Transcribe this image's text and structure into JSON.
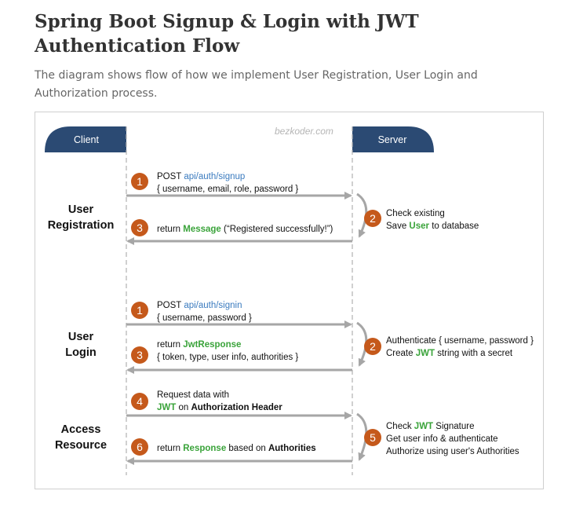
{
  "page": {
    "title": "Spring Boot Signup & Login with JWT Authentication Flow",
    "subtitle": "The diagram shows flow of how we implement User Registration, User Login and Authorization process."
  },
  "diagram": {
    "watermark": "bezkoder.com",
    "client_label": "Client",
    "server_label": "Server",
    "colors": {
      "header": "#2b4a73",
      "step": "#c5591b",
      "arrow": "#a6a6a6",
      "link": "#3b7bbf",
      "highlight": "#3aa33a"
    },
    "sections": {
      "registration": {
        "line1": "User",
        "line2": "Registration"
      },
      "login": {
        "line1": "User",
        "line2": "Login"
      },
      "access": {
        "line1": "Access",
        "line2": "Resource"
      }
    },
    "steps": {
      "reg1": {
        "num": "1",
        "method": "POST ",
        "path": "api/auth/signup",
        "body": "{ username, email, role, password }"
      },
      "reg2": {
        "num": "2",
        "line1": "Check existing",
        "line2_a": "Save ",
        "line2_b": "User",
        "line2_c": " to database"
      },
      "reg3": {
        "num": "3",
        "a": "return ",
        "b": "Message",
        "c": " (“Registered successfully!”)"
      },
      "log1": {
        "num": "1",
        "method": "POST ",
        "path": "api/auth/signin",
        "body": "{ username, password }"
      },
      "log2": {
        "num": "2",
        "line1": "Authenticate { username, password }",
        "line2_a": "Create ",
        "line2_b": "JWT",
        "line2_c": " string with a secret"
      },
      "log3": {
        "num": "3",
        "a": "return ",
        "b": "JwtResponse",
        "body": "{ token, type, user info, authorities }"
      },
      "acc4": {
        "num": "4",
        "line1": "Request  data with",
        "line2_a": "JWT",
        "line2_b": " on ",
        "line2_c": "Authorization Header"
      },
      "acc5": {
        "num": "5",
        "line1_a": "Check ",
        "line1_b": "JWT",
        "line1_c": " Signature",
        "line2": "Get user info & authenticate",
        "line3": "Authorize using user's Authorities"
      },
      "acc6": {
        "num": "6",
        "a": "return ",
        "b": "Response",
        "c": " based on ",
        "d": "Authorities"
      }
    }
  }
}
